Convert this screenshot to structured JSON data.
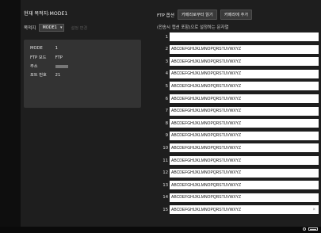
{
  "destination": {
    "header": "현재 목적지:MODE1",
    "label": "목적지",
    "select_value": "MODE1",
    "settings_button": "설정 변경"
  },
  "info": {
    "mode_key": "MODE",
    "mode_value": "1",
    "ftp_mode_key": "FTP 모드",
    "ftp_mode_value": "FTP",
    "address_key": "주소",
    "port_key": "포트 번호",
    "port_value": "21"
  },
  "ftp_options": {
    "label": "FTP 옵션",
    "buttons": [
      "카메라로부터 읽기",
      "카메라에 추가"
    ],
    "hint": "(전송시 캡션 포함)으로 설정하는 문자열"
  },
  "captions": [
    {
      "num": "1",
      "value": ""
    },
    {
      "num": "2",
      "value": "ABCDEFGHIJKLMNOPQRSTUVWXYZ"
    },
    {
      "num": "3",
      "value": "ABCDEFGHIJKLMNOPQRSTUVWXYZ"
    },
    {
      "num": "4",
      "value": "ABCDEFGHIJKLMNOPQRSTUVWXYZ"
    },
    {
      "num": "5",
      "value": "ABCDEFGHIJKLMNOPQRSTUVWXYZ"
    },
    {
      "num": "6",
      "value": "ABCDEFGHIJKLMNOPQRSTUVWXYZ"
    },
    {
      "num": "7",
      "value": "ABCDEFGHIJKLMNOPQRSTUVWXYZ"
    },
    {
      "num": "8",
      "value": "ABCDEFGHIJKLMNOPQRSTUVWXYZ"
    },
    {
      "num": "9",
      "value": "ABCDEFGHIJKLMNOPQRSTUVWXYZ"
    },
    {
      "num": "10",
      "value": "ABCDEFGHIJKLMNOPQRSTUVWXYZ"
    },
    {
      "num": "11",
      "value": "ABCDEFGHIJKLMNOPQRSTUVWXYZ"
    },
    {
      "num": "12",
      "value": "ABCDEFGHIJKLMNOPQRSTUVWXYZ"
    },
    {
      "num": "13",
      "value": "ABCDEFGHIJKLMNOPQRSTUVWXYZ"
    },
    {
      "num": "14",
      "value": "ABCDEFGHIJKLMNOPQRSTUVWXYZ"
    },
    {
      "num": "15",
      "value": "ABCDEFGHIJKLMNOPQRSTUVWXYZ"
    }
  ],
  "icons": {
    "dropdown": "chevron-down-icon",
    "clear": "clear-icon",
    "status_indicator": "status-dot-icon",
    "battery": "battery-icon"
  },
  "colors": {
    "background": "#1e1e1e",
    "panel": "#333333",
    "button": "#3a3a3a",
    "field": "#ffffff"
  }
}
